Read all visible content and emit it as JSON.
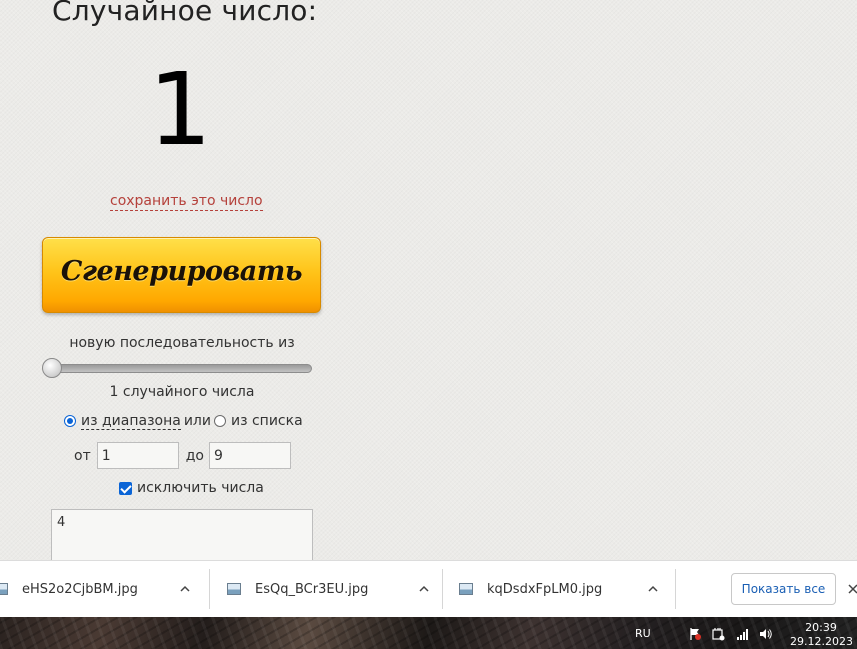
{
  "heading": "Случайное число:",
  "result": "1",
  "save_link": "сохранить это число",
  "generate_button": "Сгенерировать",
  "sequence_label": "новую последовательность из",
  "slider": {
    "value": 1,
    "min": 1
  },
  "count_label": "1 случайного числа",
  "mode": {
    "range_label": "из диапазона",
    "or_label": "или",
    "list_label": "из списка",
    "selected": "range"
  },
  "range": {
    "from_label": "от",
    "from_value": "1",
    "to_label": "до",
    "to_value": "9"
  },
  "exclude": {
    "label": "исключить числа",
    "checked": true,
    "value": "4"
  },
  "downloads": {
    "items": [
      {
        "name": "eHS2o2CjbBM.jpg"
      },
      {
        "name": "EsQq_BCr3EU.jpg"
      },
      {
        "name": "kqDsdxFpLM0.jpg"
      }
    ],
    "show_all": "Показать все"
  },
  "taskbar": {
    "language": "RU",
    "time": "20:39",
    "date": "29.12.2023"
  },
  "icons": {
    "file": "image-file-icon",
    "chevron": "chevron-up-icon",
    "close": "close-icon"
  }
}
